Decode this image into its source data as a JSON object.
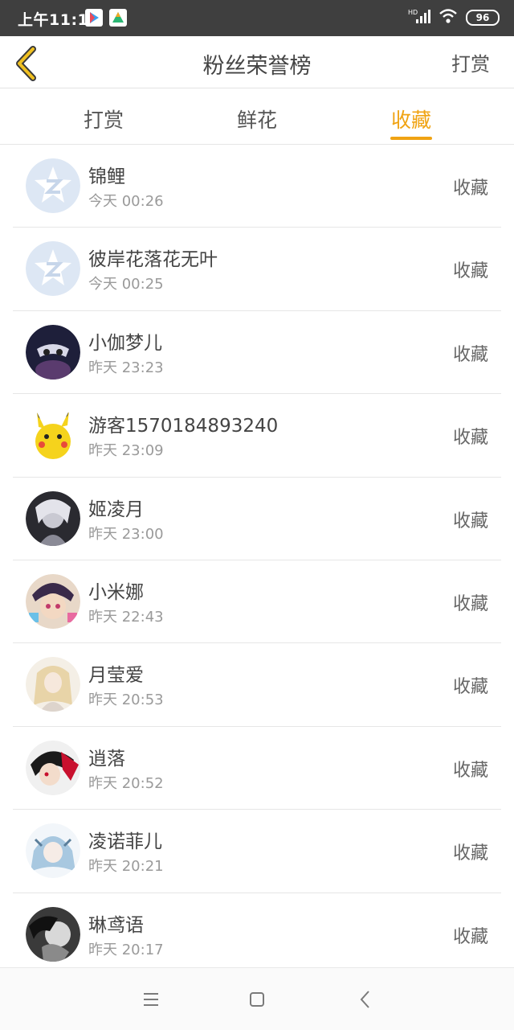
{
  "status_bar": {
    "time": "上午11:11",
    "battery": "96",
    "network_label": "HD"
  },
  "header": {
    "title": "粉丝荣誉榜",
    "action": "打赏"
  },
  "tabs": [
    {
      "label": "打赏",
      "active": false
    },
    {
      "label": "鲜花",
      "active": false
    },
    {
      "label": "收藏",
      "active": true
    }
  ],
  "colors": {
    "accent": "#f0a313",
    "status_bar": "#3f3f3f"
  },
  "list": [
    {
      "name": "锦鲤",
      "time": "今天 00:26",
      "action": "收藏",
      "avatar": "default-z"
    },
    {
      "name": "彼岸花落花无叶",
      "time": "今天 00:25",
      "action": "收藏",
      "avatar": "default-z"
    },
    {
      "name": "小伽梦儿",
      "time": "昨天 23:23",
      "action": "收藏",
      "avatar": "anime-dark"
    },
    {
      "name": "游客1570184893240",
      "time": "昨天 23:09",
      "action": "收藏",
      "avatar": "pikachu"
    },
    {
      "name": "姬凌月",
      "time": "昨天 23:00",
      "action": "收藏",
      "avatar": "anime-gray"
    },
    {
      "name": "小米娜",
      "time": "昨天 22:43",
      "action": "收藏",
      "avatar": "anime-colorful"
    },
    {
      "name": "月莹爱",
      "time": "昨天 20:53",
      "action": "收藏",
      "avatar": "anime-light"
    },
    {
      "name": "逍落",
      "time": "昨天 20:52",
      "action": "收藏",
      "avatar": "anime-red"
    },
    {
      "name": "凌诺菲儿",
      "time": "昨天 20:21",
      "action": "收藏",
      "avatar": "anime-blue"
    },
    {
      "name": "琳鸢语",
      "time": "昨天 20:17",
      "action": "收藏",
      "avatar": "anime-bw"
    }
  ]
}
